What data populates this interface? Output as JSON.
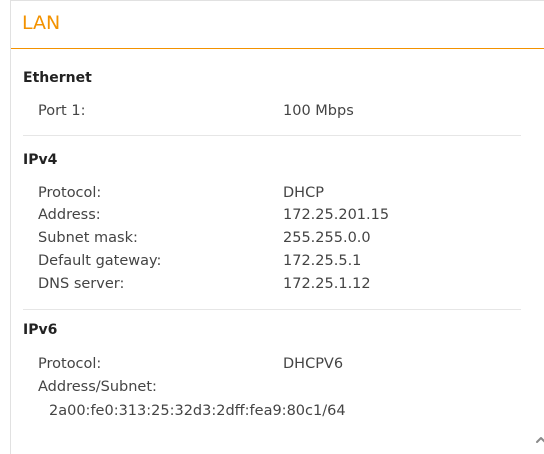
{
  "panel": {
    "title": "LAN"
  },
  "ethernet": {
    "heading": "Ethernet",
    "rows": [
      {
        "label": "Port 1:",
        "value": "100 Mbps"
      }
    ]
  },
  "ipv4": {
    "heading": "IPv4",
    "rows": [
      {
        "label": "Protocol:",
        "value": "DHCP"
      },
      {
        "label": "Address:",
        "value": "172.25.201.15"
      },
      {
        "label": "Subnet mask:",
        "value": "255.255.0.0"
      },
      {
        "label": "Default gateway:",
        "value": "172.25.5.1"
      },
      {
        "label": "DNS server:",
        "value": "172.25.1.12"
      }
    ]
  },
  "ipv6": {
    "heading": "IPv6",
    "protocol_label": "Protocol:",
    "protocol_value": "DHCPV6",
    "address_label": "Address/Subnet:",
    "address_value": "2a00:fe0:313:25:32d3:2dff:fea9:80c1/64"
  },
  "icons": {
    "scroll_up": "chevron-up-icon"
  },
  "colors": {
    "accent": "#f39200"
  }
}
